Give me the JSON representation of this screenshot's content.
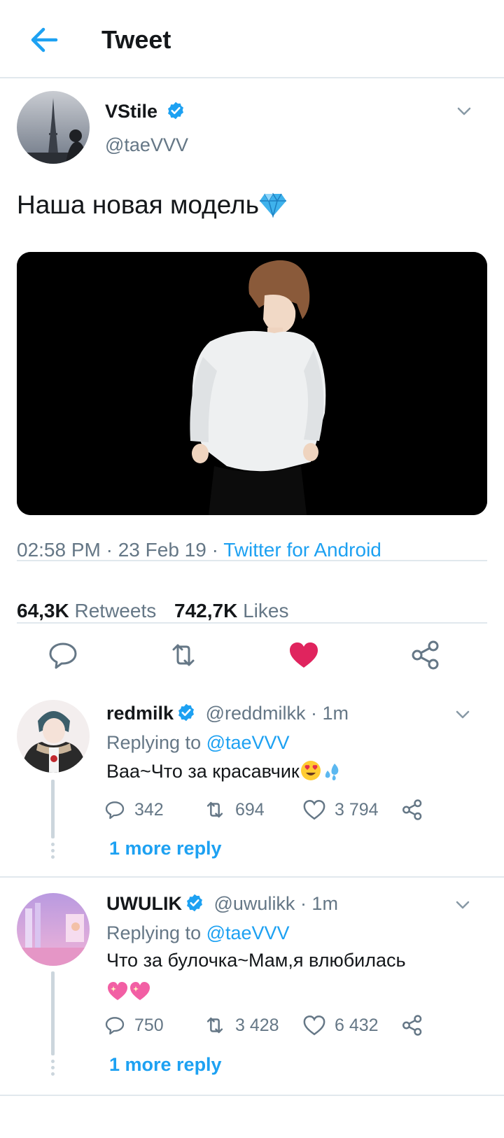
{
  "header": {
    "title": "Tweet"
  },
  "tweet": {
    "author_name": "VStile",
    "handle": "@taeVVV",
    "text": "Наша новая модель",
    "timestamp": "02:58 PM · 23 Feb 19 · ",
    "source": "Twitter for Android",
    "retweets_count": "64,3K",
    "retweets_label": "Retweets",
    "likes_count": "742,7K",
    "likes_label": "Likes"
  },
  "colors": {
    "accent": "#1da1f2",
    "like": "#e0245e",
    "muted": "#657786"
  },
  "replies": [
    {
      "name": "redmilk",
      "handle_time": "@reddmilkk · 1m",
      "replying_prefix": "Replying to ",
      "replying_to": "@taeVVV",
      "text": "Ваа~Что за красавчик",
      "reply_count": "342",
      "retweet_count": "694",
      "like_count": "3 794",
      "more_label": "1 more reply"
    },
    {
      "name": "UWULIK",
      "handle_time": "@uwulikk · 1m",
      "replying_prefix": "Replying to ",
      "replying_to": "@taeVVV",
      "text": "Что за булочка~Мам,я влюбилась",
      "reply_count": "750",
      "retweet_count": "3 428",
      "like_count": "6 432",
      "more_label": "1 more reply"
    }
  ]
}
